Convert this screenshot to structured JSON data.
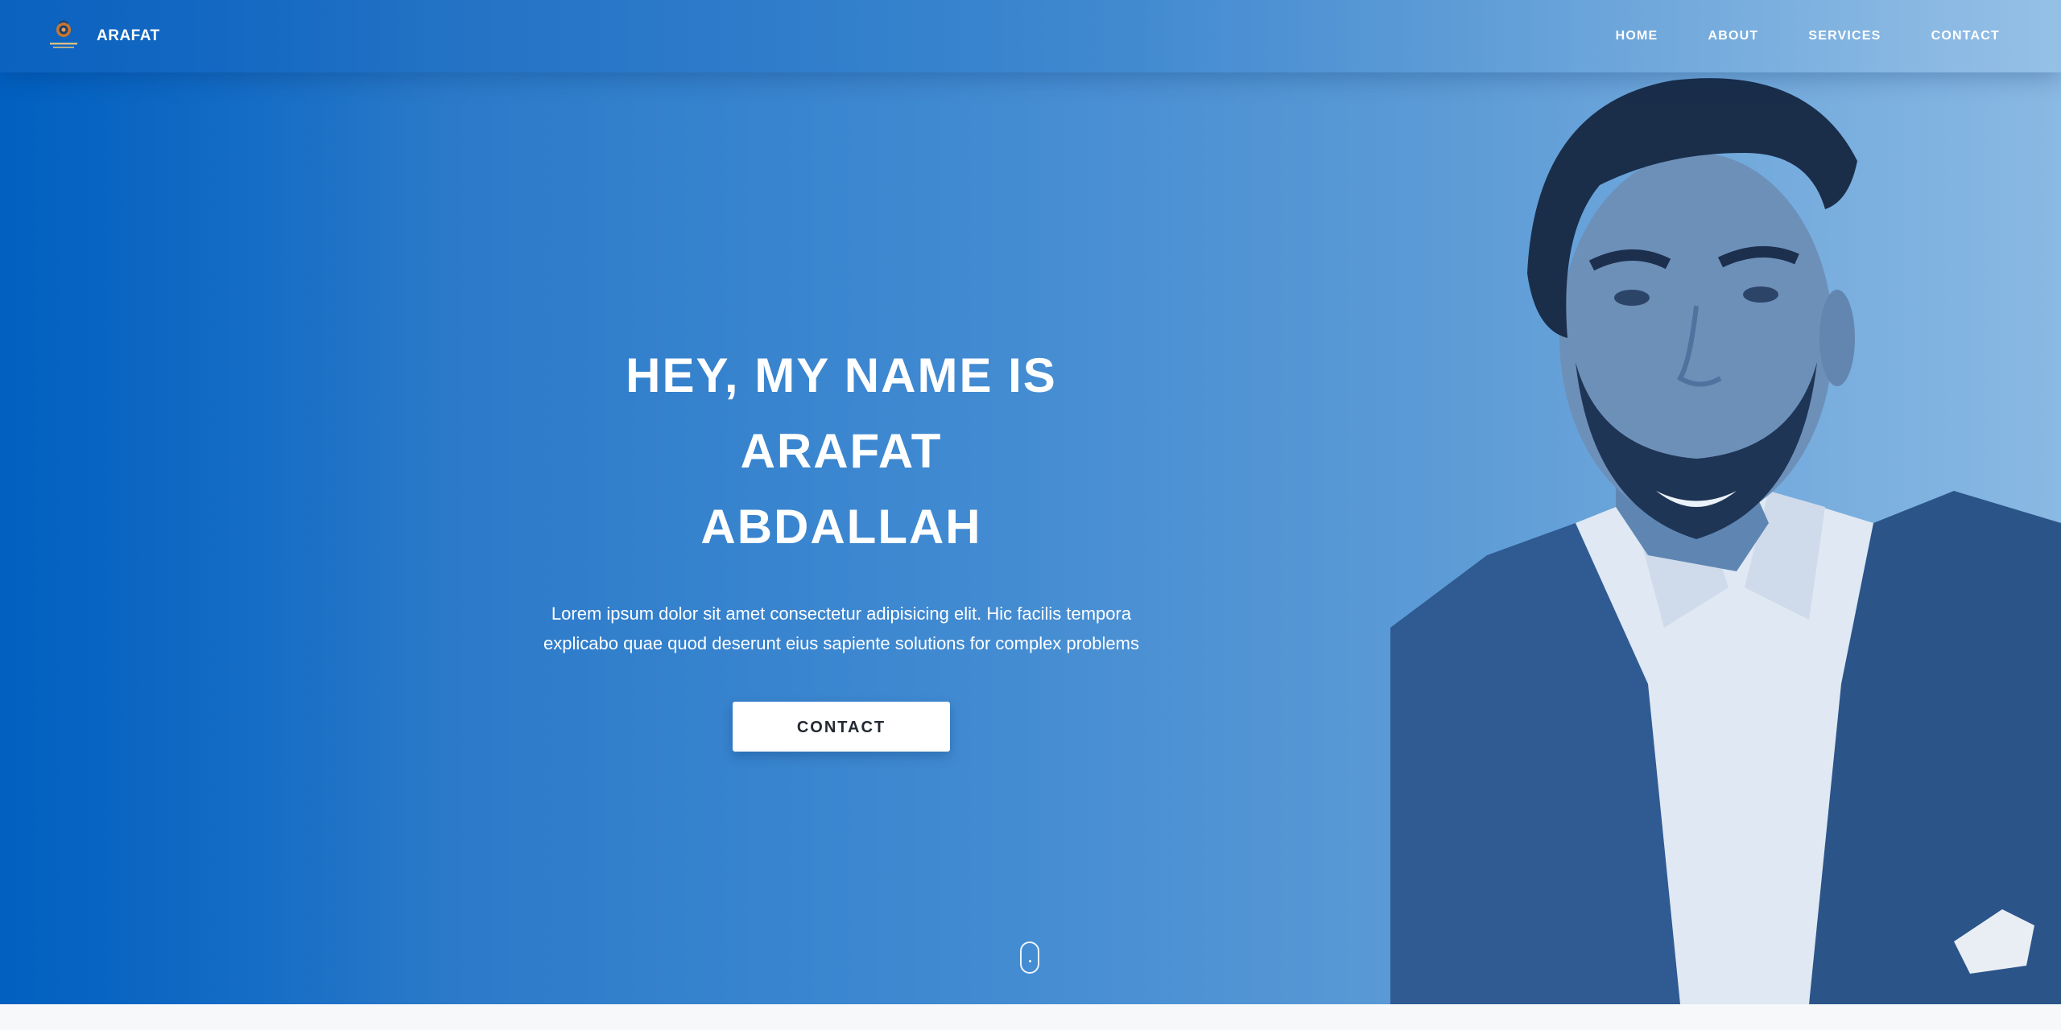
{
  "navbar": {
    "brand_name": "ARAFAT",
    "logo_icon": "brand-logo-icon",
    "items": [
      {
        "label": "HOME"
      },
      {
        "label": "ABOUT"
      },
      {
        "label": "SERVICES"
      },
      {
        "label": "CONTACT"
      }
    ]
  },
  "hero": {
    "title_line1": "HEY, MY NAME IS ARAFAT",
    "title_line2": "ABDALLAH",
    "subtitle": "Lorem ipsum dolor sit amet consectetur adipisicing elit. Hic facilis tempora explicabo quae quod deserunt eius sapiente solutions for complex problems",
    "cta_label": "CONTACT",
    "portrait_alt": "portrait-photo",
    "scroll_icon": "scroll-mouse-icon"
  },
  "colors": {
    "hero_gradient_start": "#0263c2",
    "hero_gradient_end": "#8ab9e3",
    "button_bg": "#ffffff",
    "button_text": "#222831",
    "text": "#ffffff"
  }
}
